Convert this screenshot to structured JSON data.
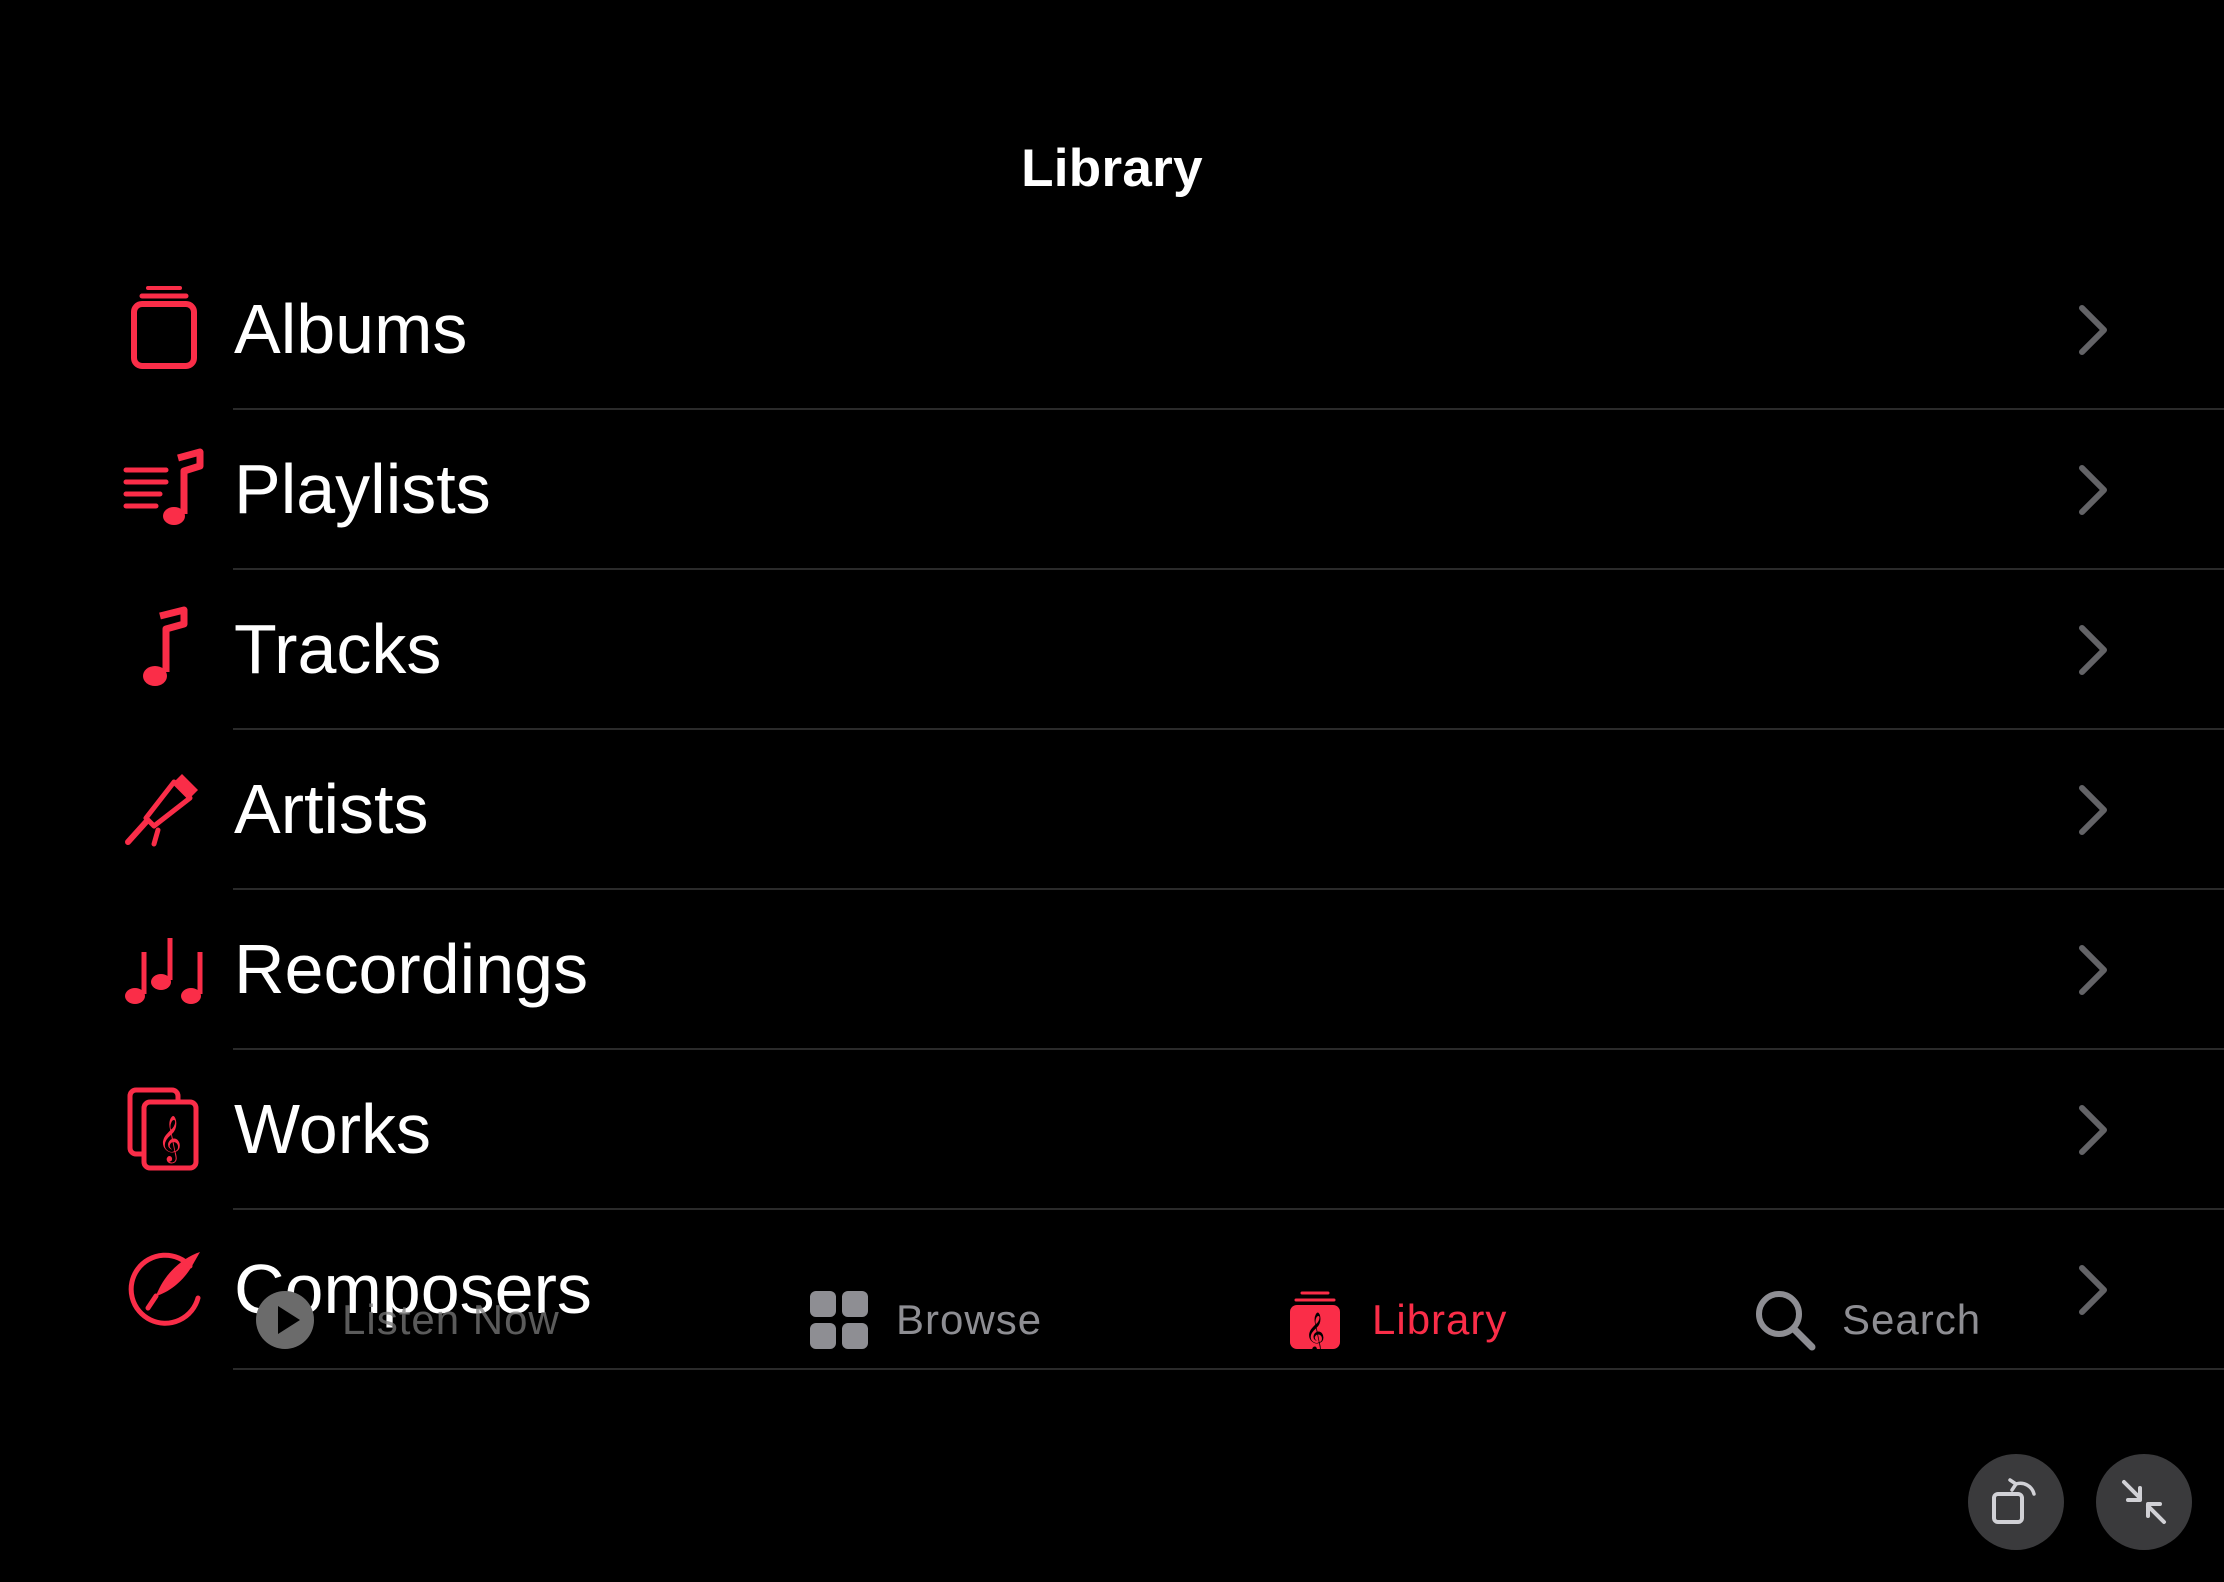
{
  "header": {
    "title": "Library"
  },
  "library_items": [
    {
      "label": "Albums",
      "icon": "albums-icon"
    },
    {
      "label": "Playlists",
      "icon": "playlists-icon"
    },
    {
      "label": "Tracks",
      "icon": "music-note-icon"
    },
    {
      "label": "Artists",
      "icon": "microphone-icon"
    },
    {
      "label": "Recordings",
      "icon": "recordings-icon"
    },
    {
      "label": "Works",
      "icon": "works-score-icon"
    },
    {
      "label": "Composers",
      "icon": "composer-quill-icon"
    }
  ],
  "tabbar": {
    "tabs": [
      {
        "label": "Listen Now",
        "icon": "play-circle-icon",
        "active": false
      },
      {
        "label": "Browse",
        "icon": "grid-icon",
        "active": false
      },
      {
        "label": "Library",
        "icon": "library-icon",
        "active": true
      },
      {
        "label": "Search",
        "icon": "search-icon",
        "active": false
      }
    ]
  },
  "colors": {
    "accent": "#fa2d48",
    "background": "#000000",
    "text": "#ffffff",
    "inactive_tab": "#8e8e93",
    "separator": "#2a2a2a",
    "chevron": "#636366",
    "floating_button": "#3a3a3c"
  },
  "floating_controls": [
    {
      "icon": "rotate-icon"
    },
    {
      "icon": "minimize-icon"
    }
  ]
}
